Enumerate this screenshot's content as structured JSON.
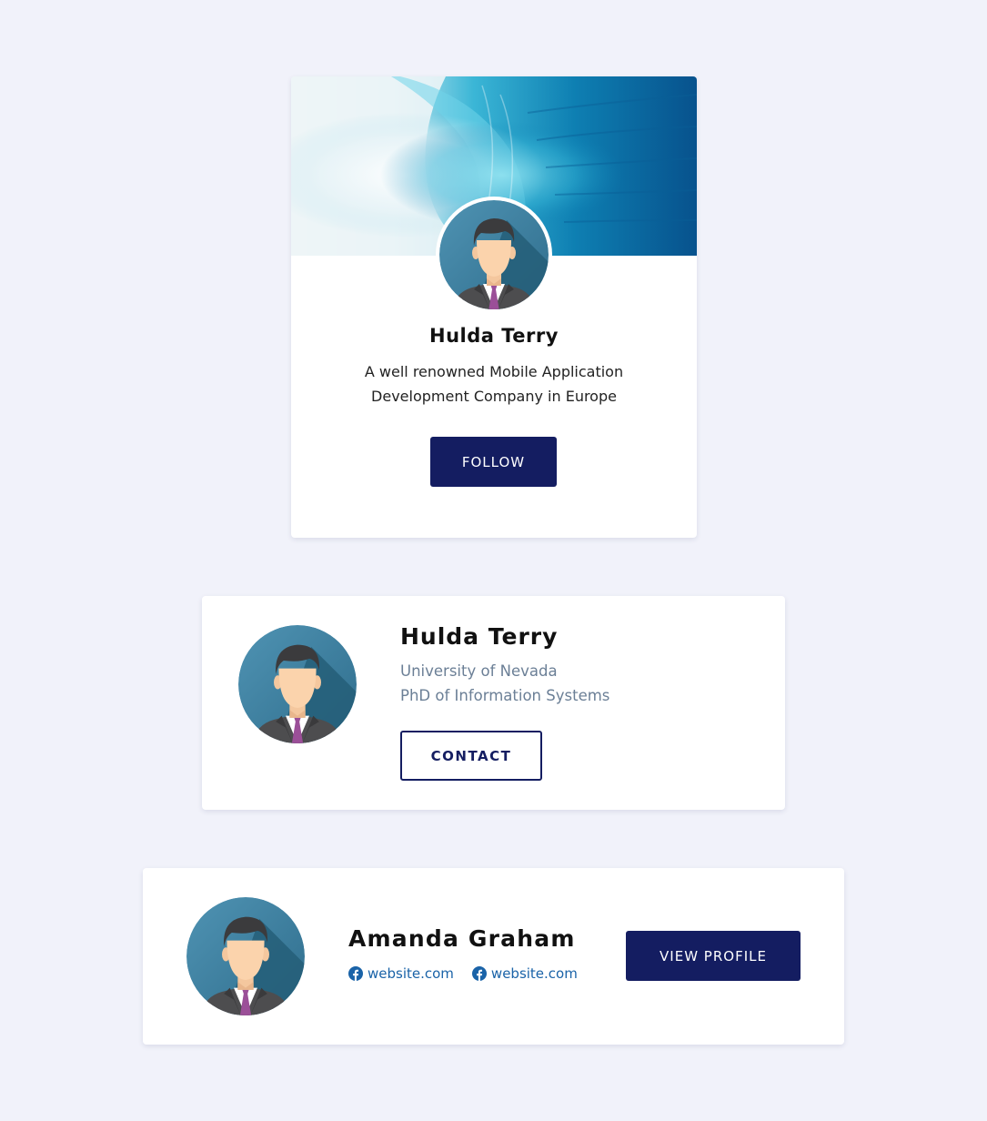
{
  "colors": {
    "page_background": "#f1f2fa",
    "primary": "#141d61",
    "muted_text": "#6b7f96",
    "link": "#1a63a8"
  },
  "card1": {
    "cover_image": "ocean-wave",
    "avatar_icon": "businessman-avatar",
    "name": "Hulda Terry",
    "description": "A well renowned Mobile Application Development Company in Europe",
    "button_label": "FOLLOW"
  },
  "card2": {
    "avatar_icon": "businessman-avatar",
    "name": "Hulda Terry",
    "line1": "University of Nevada",
    "line2": "PhD of Information Systems",
    "button_label": "CONTACT"
  },
  "card3": {
    "avatar_icon": "businessman-avatar",
    "name": "Amanda Graham",
    "links": [
      {
        "icon": "facebook-icon",
        "label": "website.com"
      },
      {
        "icon": "facebook-icon",
        "label": "website.com"
      }
    ],
    "button_label": "VIEW PROFILE"
  }
}
